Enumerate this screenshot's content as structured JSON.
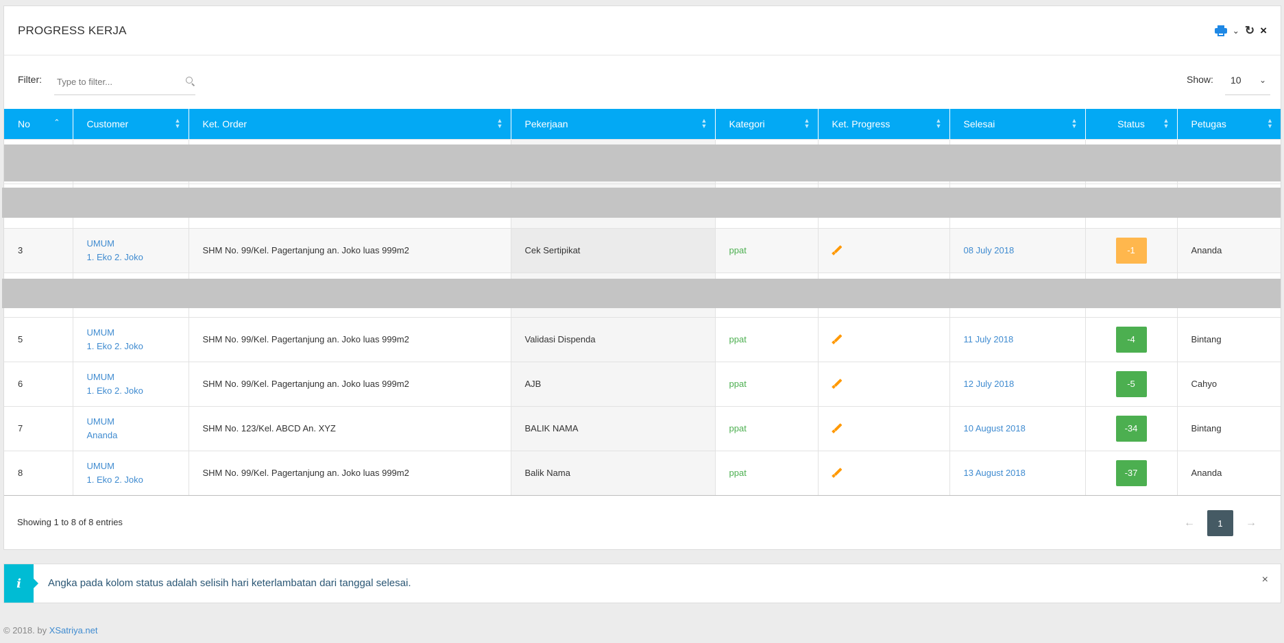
{
  "panel": {
    "title": "PROGRESS KERJA",
    "tools": [
      "printer-icon",
      "chevron-down-icon",
      "refresh-icon",
      "close-icon"
    ]
  },
  "filter": {
    "label": "Filter:",
    "placeholder": "Type to filter...",
    "value": ""
  },
  "show": {
    "label": "Show:",
    "value": "10"
  },
  "table": {
    "columns": [
      "No",
      "Customer",
      "Ket. Order",
      "Pekerjaan",
      "Kategori",
      "Ket. Progress",
      "Selesai",
      "Status",
      "Petugas"
    ],
    "rows": [
      {
        "no": "3",
        "cust1": "UMUM",
        "cust2": "1. Eko 2. Joko",
        "order": "SHM No. 99/Kel. Pagertanjung an. Joko luas 999m2",
        "pekerjaan": "Cek Sertipikat",
        "kategori": "ppat",
        "selesai": "08 July 2018",
        "status": "-1",
        "status_color": "orange",
        "petugas": "Ananda"
      },
      {
        "no": "5",
        "cust1": "UMUM",
        "cust2": "1. Eko 2. Joko",
        "order": "SHM No. 99/Kel. Pagertanjung an. Joko luas 999m2",
        "pekerjaan": "Validasi Dispenda",
        "kategori": "ppat",
        "selesai": "11 July 2018",
        "status": "-4",
        "status_color": "green",
        "petugas": "Bintang"
      },
      {
        "no": "6",
        "cust1": "UMUM",
        "cust2": "1. Eko 2. Joko",
        "order": "SHM No. 99/Kel. Pagertanjung an. Joko luas 999m2",
        "pekerjaan": "AJB",
        "kategori": "ppat",
        "selesai": "12 July 2018",
        "status": "-5",
        "status_color": "green",
        "petugas": "Cahyo"
      },
      {
        "no": "7",
        "cust1": "UMUM",
        "cust2": "Ananda",
        "order": "SHM No. 123/Kel. ABCD An. XYZ",
        "pekerjaan": "BALIK NAMA",
        "kategori": "ppat",
        "selesai": "10 August 2018",
        "status": "-34",
        "status_color": "green",
        "petugas": "Bintang"
      },
      {
        "no": "8",
        "cust1": "UMUM",
        "cust2": "1. Eko 2. Joko",
        "order": "SHM No. 99/Kel. Pagertanjung an. Joko luas 999m2",
        "pekerjaan": "Balik Nama",
        "kategori": "ppat",
        "selesai": "13 August 2018",
        "status": "-37",
        "status_color": "green",
        "petugas": "Ananda"
      }
    ]
  },
  "footer": {
    "info": "Showing 1 to 8 of 8 entries",
    "prev": "←",
    "page": "1",
    "next": "→"
  },
  "alert": {
    "icon": "i",
    "text": "Angka pada kolom status adalah selisih hari keterlambatan dari tanggal selesai.",
    "close": "×"
  },
  "copyright": {
    "prefix": "© 2018. by ",
    "link": "XSatriya.net"
  },
  "colors": {
    "header_bg": "#03a9f4",
    "link": "#3f8bd0",
    "kategori": "#4caf50",
    "badge_orange": "#ffb74d",
    "badge_green": "#4caf50",
    "pager_active": "#455a64",
    "alert_accent": "#00bcd4"
  }
}
